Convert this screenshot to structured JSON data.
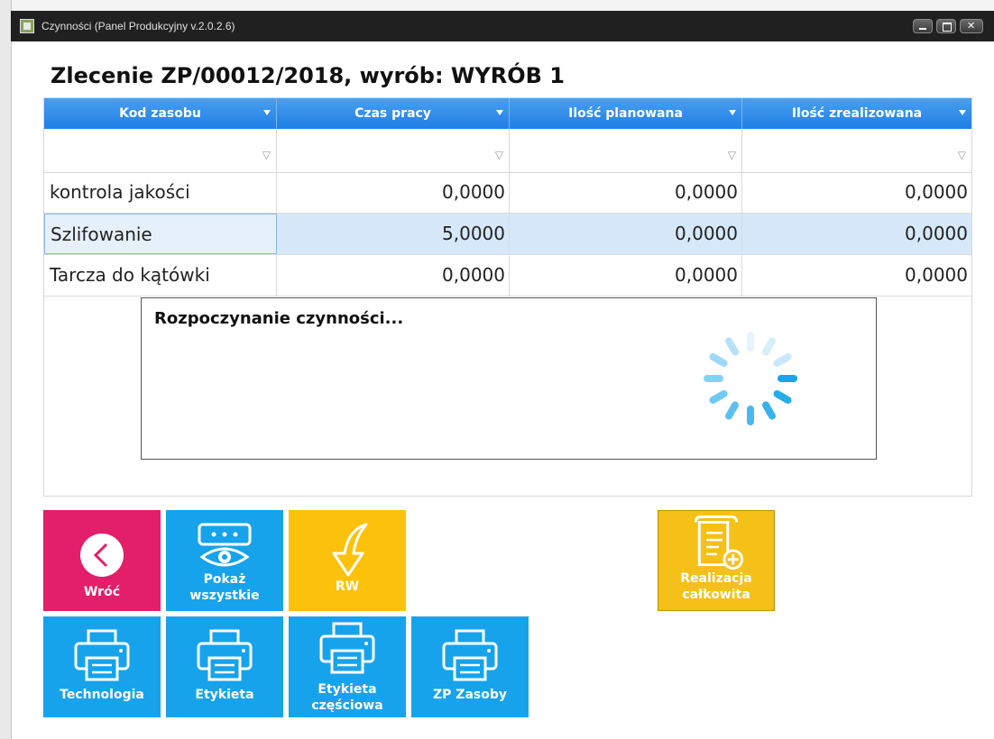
{
  "window": {
    "title": "Czynności (Panel Produkcyjny v.2.0.2.6)"
  },
  "heading": "Zlecenie ZP/00012/2018, wyrób: WYRÓB 1",
  "grid": {
    "columns": [
      "Kod zasobu",
      "Czas pracy",
      "Ilość planowana",
      "Ilość zrealizowana"
    ],
    "rows": [
      [
        "kontrola jakości",
        "0,0000",
        "0,0000",
        "0,0000"
      ],
      [
        "Szlifowanie",
        "5,0000",
        "0,0000",
        "0,0000"
      ],
      [
        "Tarcza do kątówki",
        "0,0000",
        "0,0000",
        "0,0000"
      ]
    ],
    "selected_row_index": 1
  },
  "progress": {
    "message": "Rozpoczynanie czynności..."
  },
  "tiles": {
    "back": {
      "label": "Wróć",
      "icon": "back-arrow-icon",
      "color": "#e21f68"
    },
    "show_all": {
      "label_line1": "Pokaż",
      "label_line2": "wszystkie",
      "icon": "eye-icon",
      "color": "#16a3ec"
    },
    "rw": {
      "label": "RW",
      "icon": "curved-arrow-down-icon",
      "color": "#fcc20b"
    },
    "realization": {
      "label_line1": "Realizacja",
      "label_line2": "całkowita",
      "icon": "document-add-icon",
      "color": "#f5c018"
    },
    "technologia": {
      "label": "Technologia",
      "icon": "printer-icon",
      "color": "#16a3ec"
    },
    "etykieta": {
      "label": "Etykieta",
      "icon": "printer-icon",
      "color": "#16a3ec"
    },
    "etykieta_czesciowa": {
      "label_line1": "Etykieta",
      "label_line2": "częściowa",
      "icon": "printer-icon",
      "color": "#16a3ec"
    },
    "zp_zasoby": {
      "label": "ZP Zasoby",
      "icon": "printer-icon",
      "color": "#16a3ec"
    }
  }
}
